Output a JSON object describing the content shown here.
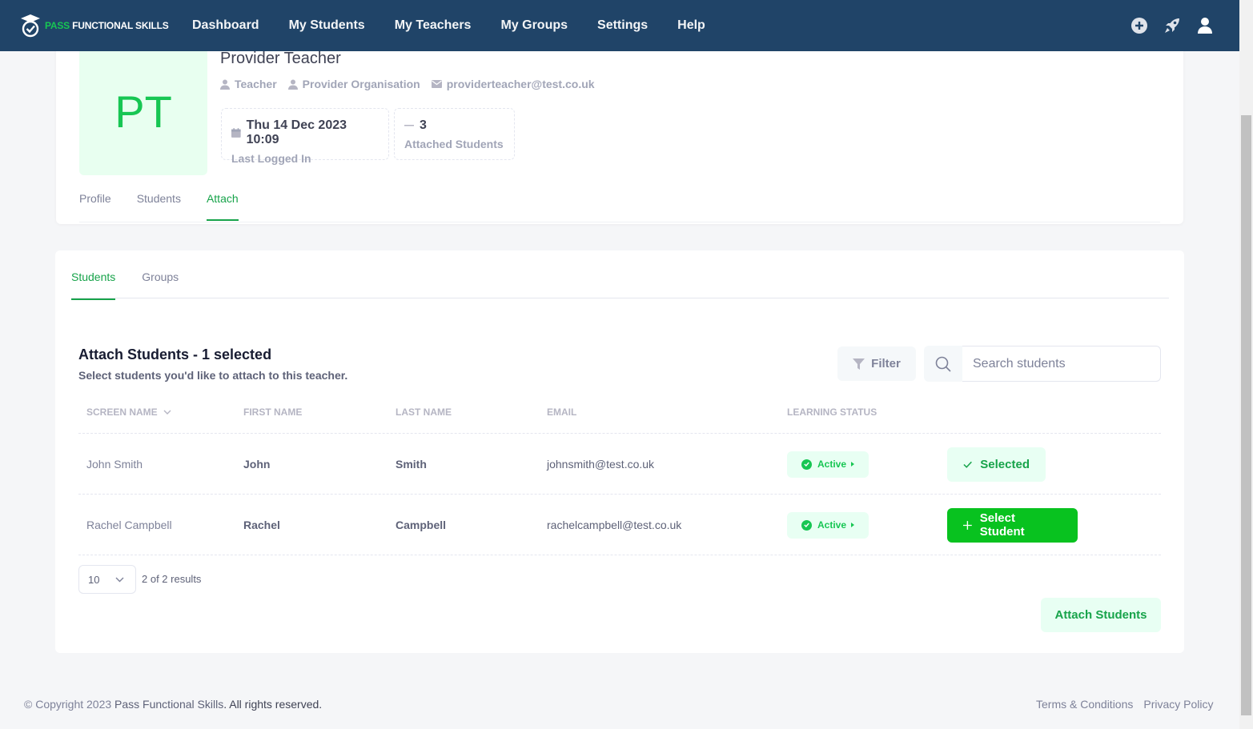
{
  "brand": {
    "pass": "PASS",
    "rest": "FUNCTIONAL SKILLS"
  },
  "nav": [
    "Dashboard",
    "My Students",
    "My Teachers",
    "My Groups",
    "Settings",
    "Help"
  ],
  "nav_icons": [
    "plus-circle-icon",
    "rocket-icon",
    "user-icon"
  ],
  "profile": {
    "initials": "PT",
    "name": "Provider Teacher",
    "role": "Teacher",
    "organisation": "Provider Organisation",
    "email": "providerteacher@test.co.uk",
    "last_logged_in_value": "Thu 14 Dec 2023 10:09",
    "last_logged_in_label": "Last Logged In",
    "attached_value": "3",
    "attached_label": "Attached Students",
    "tabs": [
      "Profile",
      "Students",
      "Attach"
    ],
    "active_tab": "Attach"
  },
  "attach": {
    "tabs": [
      "Students",
      "Groups"
    ],
    "active_tab": "Students",
    "title": "Attach Students - 1 selected",
    "subtitle": "Select students you'd like to attach to this teacher.",
    "filter_label": "Filter",
    "search_placeholder": "Search students",
    "columns": [
      "Screen Name",
      "First Name",
      "Last Name",
      "Email",
      "Learning Status"
    ],
    "rows": [
      {
        "screen": "John Smith",
        "first": "John",
        "last": "Smith",
        "email": "johnsmith@test.co.uk",
        "status": "Active",
        "action": "Selected"
      },
      {
        "screen": "Rachel Campbell",
        "first": "Rachel",
        "last": "Campbell",
        "email": "rachelcampbell@test.co.uk",
        "status": "Active",
        "action": "Select Student"
      }
    ],
    "page_size": "10",
    "results": "2 of 2 results",
    "attach_button": "Attach Students"
  },
  "footer": {
    "copyright_prefix": "© Copyright 2023 ",
    "copyright_brand": "Pass Functional Skills",
    "copyright_suffix": ". All rights reserved.",
    "terms": "Terms & Conditions",
    "privacy": "Privacy Policy"
  },
  "colors": {
    "nav_bg": "#204468",
    "accent_green": "#17c653",
    "button_green": "#08c21f"
  }
}
